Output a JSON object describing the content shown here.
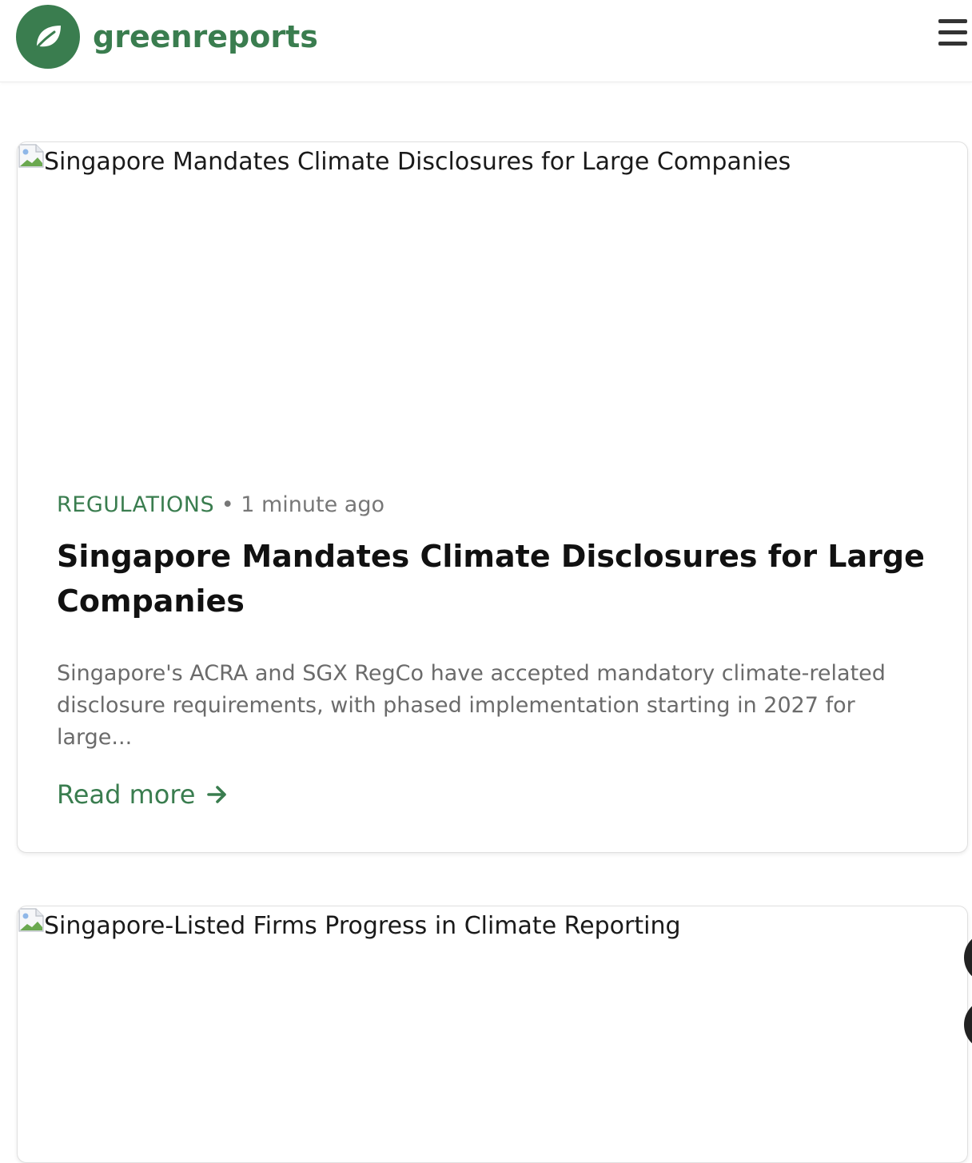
{
  "header": {
    "brand": "greenreports"
  },
  "articles": [
    {
      "image_alt": "Singapore Mandates Climate Disclosures for Large Companies",
      "category": "REGULATIONS",
      "separator": "•",
      "time": "1 minute ago",
      "title": "Singapore Mandates Climate Disclosures for Large Companies",
      "excerpt": "Singapore's ACRA and SGX RegCo have accepted mandatory climate-related disclosure requirements, with phased implementation starting in 2027 for large...",
      "read_more": "Read more"
    },
    {
      "image_alt": "Singapore-Listed Firms Progress in Climate Reporting"
    }
  ],
  "colors": {
    "brand_green": "#3a7d4f",
    "text_dark": "#111111",
    "text_muted": "#6b6b6b"
  },
  "icons": {
    "logo": "leaf-icon",
    "menu": "hamburger-menu-icon",
    "broken_image": "broken-image-icon",
    "read_more": "arrow-right-icon"
  }
}
